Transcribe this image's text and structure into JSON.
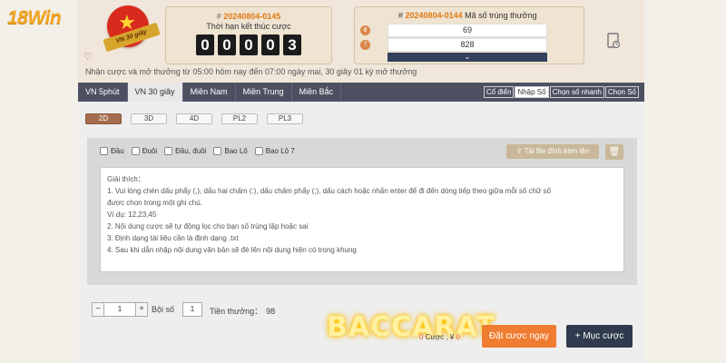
{
  "brand": {
    "logo_text": "18Win"
  },
  "header": {
    "badge_text": "VN 30 giây",
    "current_draw": {
      "hash": "#",
      "number": "20240804-0145",
      "label": "Thời hạn kết thúc cược",
      "countdown": [
        "0",
        "0",
        "0",
        "0",
        "3"
      ]
    },
    "last_draw": {
      "hash": "#",
      "number": "20240804-0144",
      "label": "Mã số trúng thưởng",
      "rows": [
        {
          "rank": "8",
          "value": "69"
        },
        {
          "rank": "7",
          "value": "828"
        }
      ]
    },
    "info_text": "Nhận cược và mở thưởng từ 05:00 hôm nay đến 07:00 ngày mai,   30 giây 01 kỳ mở thưởng"
  },
  "tabs": [
    "VN 5phút",
    "VN 30 giây",
    "Miền Nam",
    "Miền Trung",
    "Miền Bắc"
  ],
  "active_tab": 1,
  "modes": [
    "Cổ điển",
    "Nhập Số",
    "Chọn số nhanh",
    "Chọn Số"
  ],
  "active_mode": 1,
  "sub_tabs": [
    "2D",
    "3D",
    "4D",
    "PL2",
    "PL3"
  ],
  "active_sub_tab": 0,
  "options": [
    "Đầu",
    "Đuôi",
    "Đầu, đuôi",
    "Bao Lô",
    "Bao Lô 7"
  ],
  "upload_label": "Tải file đính kèm lên",
  "instructions": [
    "Giải thích：",
    "1. Vui lòng chèn dấu phẩy (,), dấu hai chấm (:), dấu chấm phẩy (;), dấu cách hoặc nhấn enter để đi đến dòng tiếp theo giữa mỗi số chữ số",
    "được chọn trong một ghi chú.",
    "Ví dụ: 12,23,45",
    "2. Nội dung cược sẽ tự động lọc cho bạn số trùng lặp hoặc sai",
    "3. Định dạng tài liệu cần là định dạng .txt",
    "4. Sau khi dẫn nhập nội dung văn bản sẽ đè lên nội dung hiện có trong khung"
  ],
  "bet": {
    "stepper_minus": "−",
    "stepper_value": "1",
    "stepper_plus": "+",
    "multiplier_label": "Bội số",
    "multiplier_value": "1",
    "prize_label": "Tiền thưởng：",
    "prize_value": "98",
    "count": "0",
    "count_label": "Cược ,",
    "currency": "¥",
    "amount": "0",
    "place_button": "Đặt cược ngay",
    "list_button": "+ Mục cược"
  },
  "watermark": "BACCARAT",
  "colors": {
    "accent_orange": "#f07c31",
    "navy": "#2f3a4e",
    "tab_bar": "#4d5061",
    "badge_red": "#d92b1d"
  },
  "icons": [
    "heart-icon",
    "star-icon",
    "document-icon",
    "chevron-down-icon",
    "upload-icon",
    "trash-icon"
  ]
}
